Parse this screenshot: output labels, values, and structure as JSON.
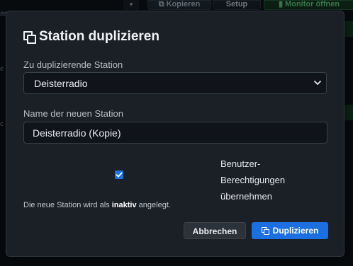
{
  "background": {
    "copy_label": "Kopieren",
    "setup_label": "Setup",
    "monitor_label": "Monitor öffnen",
    "side_fragments": [
      "as",
      "e",
      "c"
    ]
  },
  "dialog": {
    "title": "Station duplizieren",
    "source_label": "Zu duplizierende Station",
    "source_value": "Deisterradio",
    "name_label": "Name der neuen Station",
    "name_value": "Deisterradio (Kopie)",
    "copy_permissions_label": "Benutzer-Berechtigungen übernehmen",
    "copy_permissions_checked": true,
    "note_prefix": "Die neue Station wird als",
    "note_bold": "inaktiv",
    "note_suffix": "angelegt.",
    "cancel_label": "Abbrechen",
    "submit_label": "Duplizieren"
  },
  "colors": {
    "accent": "#1b6fe0",
    "dialog_bg": "#1b1f26"
  }
}
